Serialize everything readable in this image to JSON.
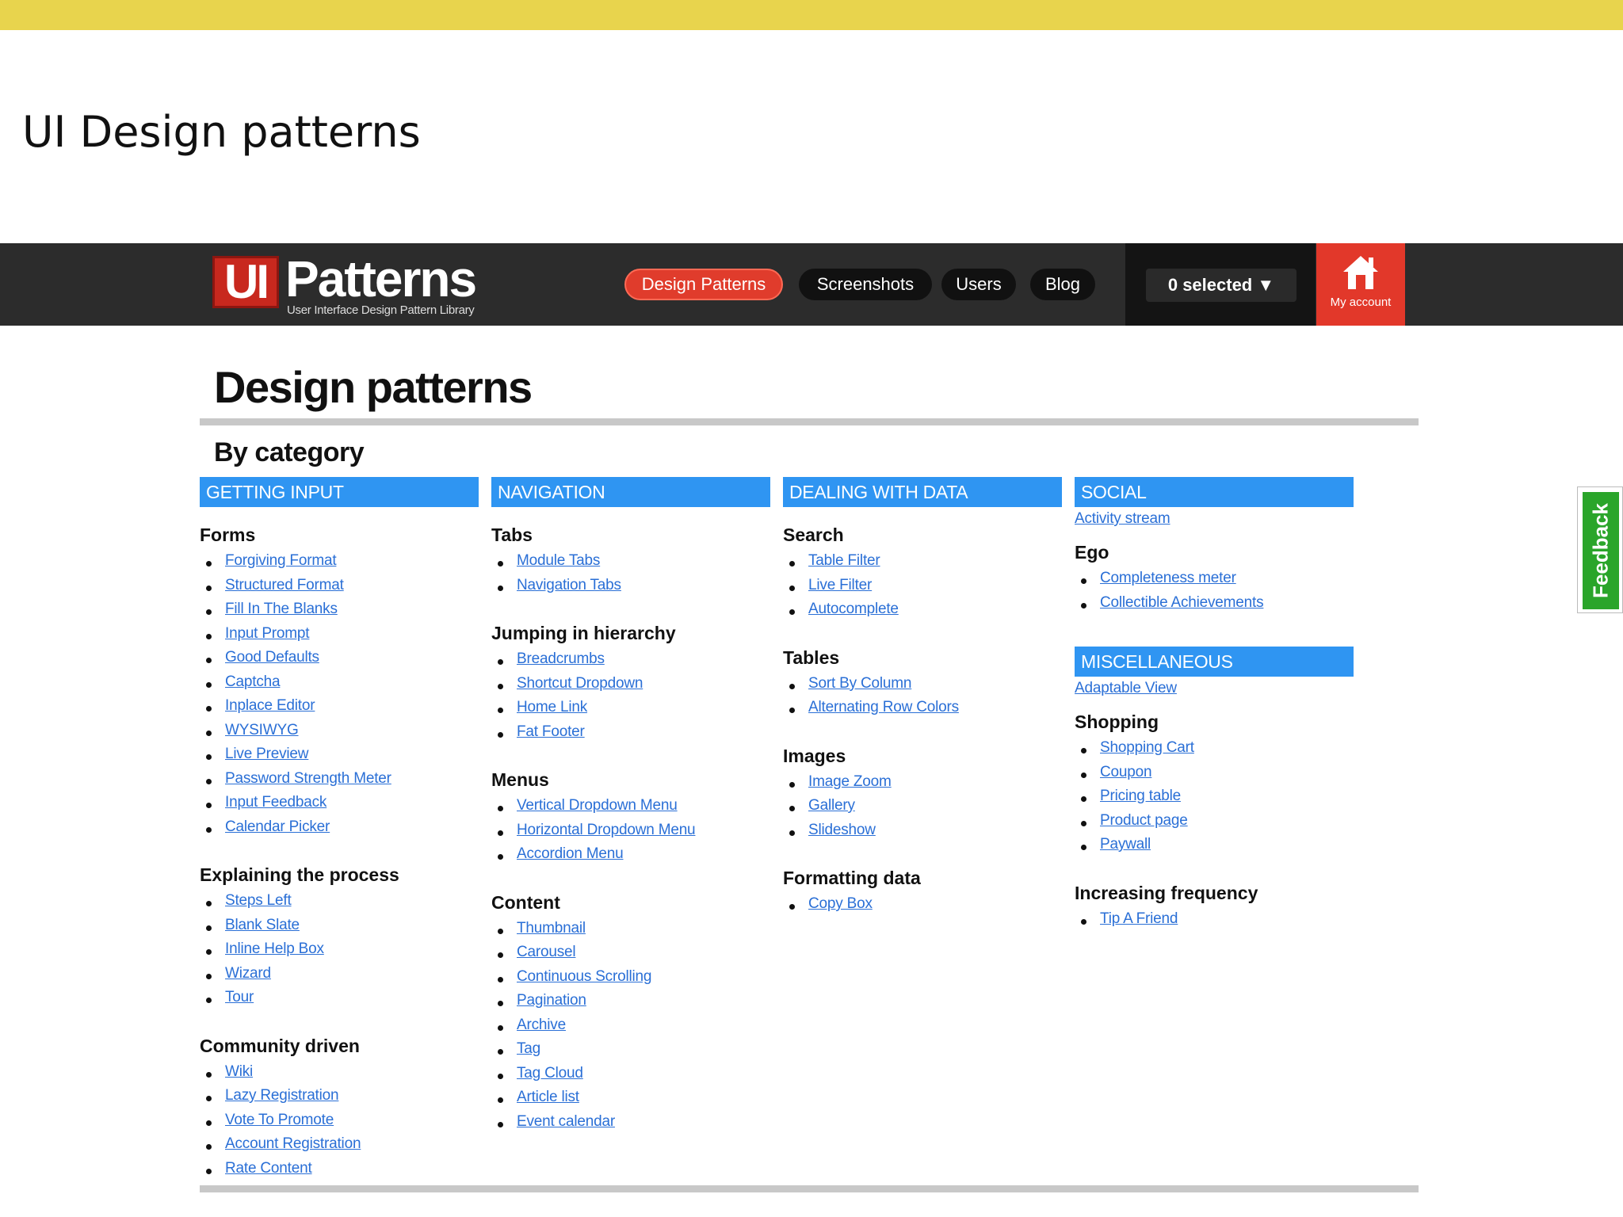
{
  "slide": {
    "title": "UI Design patterns"
  },
  "header": {
    "logo_mark": "UI",
    "logo_name": "Patterns",
    "logo_tagline": "User Interface Design Pattern Library",
    "nav": [
      "Design Patterns",
      "Screenshots",
      "Users",
      "Blog"
    ],
    "selected": "0 selected ▼",
    "account_label": "My account"
  },
  "page": {
    "heading": "Design patterns",
    "by_category": "By category"
  },
  "columns": [
    {
      "category": "GETTING INPUT",
      "groups": [
        {
          "title": "Forms",
          "links": [
            "Forgiving Format",
            "Structured Format",
            "Fill In The Blanks",
            "Input Prompt",
            "Good Defaults",
            "Captcha",
            "Inplace Editor",
            "WYSIWYG",
            "Live Preview",
            "Password Strength Meter",
            "Input Feedback",
            "Calendar Picker"
          ]
        },
        {
          "title": "Explaining the process",
          "links": [
            "Steps Left",
            "Blank Slate",
            "Inline Help Box",
            "Wizard",
            "Tour"
          ]
        },
        {
          "title": "Community driven",
          "links": [
            "Wiki",
            "Lazy Registration",
            "Vote To Promote",
            "Account Registration",
            "Rate Content"
          ]
        }
      ]
    },
    {
      "category": "NAVIGATION",
      "groups": [
        {
          "title": "Tabs",
          "links": [
            "Module Tabs",
            "Navigation Tabs"
          ]
        },
        {
          "title": "Jumping in hierarchy",
          "links": [
            "Breadcrumbs",
            "Shortcut Dropdown",
            "Home Link",
            "Fat Footer"
          ]
        },
        {
          "title": "Menus",
          "links": [
            "Vertical Dropdown Menu",
            "Horizontal Dropdown Menu",
            "Accordion Menu"
          ]
        },
        {
          "title": "Content",
          "links": [
            "Thumbnail",
            "Carousel",
            "Continuous Scrolling",
            "Pagination",
            "Archive",
            "Tag",
            "Tag Cloud",
            "Article list",
            "Event calendar"
          ]
        }
      ]
    },
    {
      "category": "DEALING WITH DATA",
      "groups": [
        {
          "title": "Search",
          "links": [
            "Table Filter",
            "Live Filter",
            "Autocomplete"
          ]
        },
        {
          "title": "Tables",
          "links": [
            "Sort By Column",
            "Alternating Row Colors"
          ]
        },
        {
          "title": "Images",
          "links": [
            "Image Zoom",
            "Gallery",
            "Slideshow"
          ]
        },
        {
          "title": "Formatting data",
          "links": [
            "Copy Box"
          ]
        }
      ]
    },
    {
      "category": "SOCIAL",
      "lead_link": "Activity stream",
      "groups": [
        {
          "title": "Ego",
          "links": [
            "Completeness meter",
            "Collectible Achievements"
          ]
        }
      ]
    },
    {
      "category": "MISCELLANEOUS",
      "lead_link": "Adaptable View",
      "groups": [
        {
          "title": "Shopping",
          "links": [
            "Shopping Cart",
            "Coupon",
            "Pricing table",
            "Product page",
            "Paywall"
          ]
        },
        {
          "title": "Increasing frequency",
          "links": [
            "Tip A Friend"
          ]
        }
      ]
    }
  ],
  "feedback": "Feedback",
  "colors": {
    "accent_yellow": "#e8d44d",
    "category_blue": "#2f95f2",
    "brand_red": "#e03c2c",
    "link_blue": "#2a6fd6",
    "feedback_green": "#2aa52a"
  }
}
